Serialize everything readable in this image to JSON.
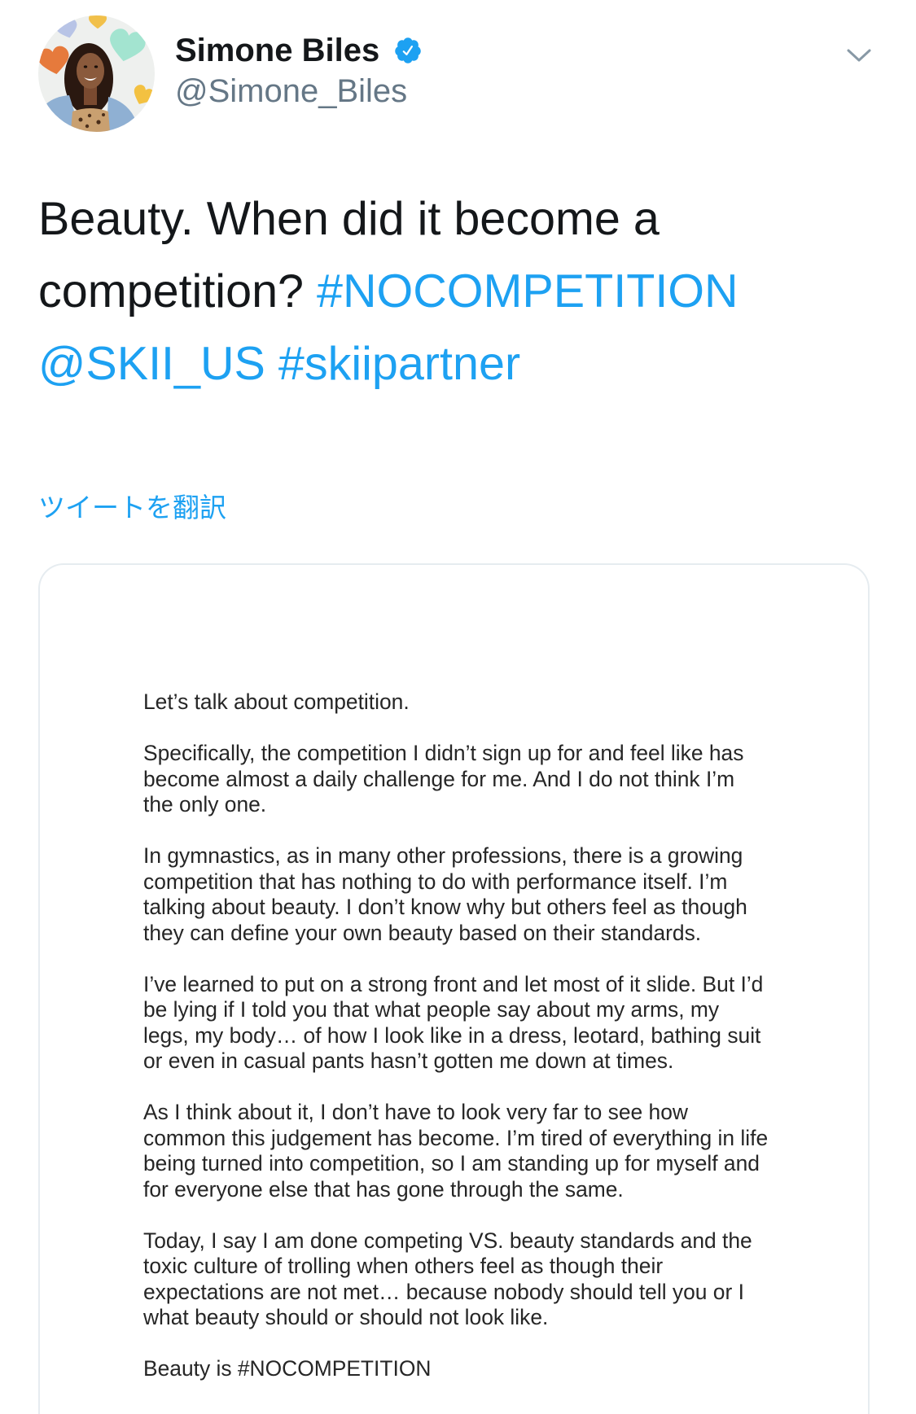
{
  "author": {
    "display_name": "Simone Biles",
    "handle": "@Simone_Biles",
    "verified": true
  },
  "tweet": {
    "lines": [
      {
        "text": "Beauty. When did it become a"
      },
      {
        "text": "competition?",
        "hashtag": "#NOCOMPETITION"
      },
      {
        "mention": "@SKII_US",
        "hashtag": "#skiipartner"
      }
    ]
  },
  "translate": {
    "label": "ツイートを翻訳"
  },
  "media": {
    "document": {
      "paragraphs": [
        [
          "Let’s talk about competition."
        ],
        [
          "Specifically, the competition I didn’t sign up for and feel like has",
          "become almost a daily challenge for me. And I do not think I’m",
          "the only one."
        ],
        [
          "In gymnastics, as in many other professions, there is a growing",
          "competition that has nothing to do with performance itself. I’m",
          "talking about beauty. I don’t know why but others feel as though",
          "they can define your own beauty based on their standards."
        ],
        [
          "I’ve learned to put on a strong front and let most of it slide. But I’d",
          "be lying if I told you that what people say about my arms, my",
          "legs, my body… of how I look like in a dress, leotard, bathing suit",
          "or even in casual pants hasn’t gotten me down at times."
        ],
        [
          "As I think about it, I don’t have to look very far to see how",
          "common this judgement has become. I’m tired of everything in life",
          "being turned into competition, so I am standing up for myself and",
          "for everyone else that has gone through the same."
        ],
        [
          "Today, I say I am done competing VS. beauty standards and the",
          "toxic culture of trolling when others feel as though their",
          "expectations are not met… because nobody should tell you or I",
          "what beauty should or should not look like."
        ],
        [
          "Beauty is #NOCOMPETITION"
        ]
      ]
    }
  },
  "icons": {
    "verified": "verified-badge-icon",
    "menu": "chevron-down-icon"
  },
  "colors": {
    "text": "#14171A",
    "secondary": "#657786",
    "link": "#1DA1F2",
    "card_border": "#E6ECF0",
    "icon": "#8899A6",
    "document_text": "#262626"
  }
}
